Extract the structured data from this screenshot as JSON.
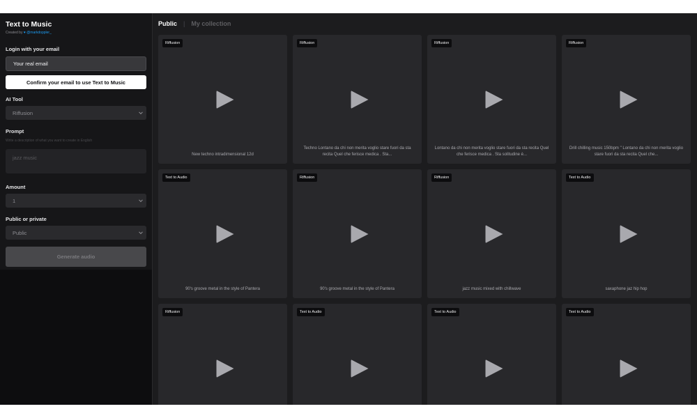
{
  "sidebar": {
    "title": "Text to Music",
    "created_prefix": "Created by",
    "created_handle": "@markdoppler_",
    "login_label": "Login with your email",
    "email_value": "Your real email",
    "confirm_button": "Confirm your email to use Text to Music",
    "ai_tool_label": "AI Tool",
    "ai_tool_value": "Riffusion",
    "prompt_label": "Prompt",
    "prompt_hint": "Write a description of what you want to create in English",
    "prompt_placeholder": "jazz music",
    "amount_label": "Amount",
    "amount_value": "1",
    "privacy_label": "Public or private",
    "privacy_value": "Public",
    "generate_button": "Generate audio"
  },
  "tabs": {
    "public": "Public",
    "separator": "|",
    "collection": "My collection"
  },
  "cards": [
    {
      "badge": "Riffusion",
      "caption": "New techno intradimensional 12d"
    },
    {
      "badge": "Riffusion",
      "caption": "Techno Lontano da chi non merita voglio stare fuori da sta recita Quel che ferisce medica . Sta..."
    },
    {
      "badge": "Riffusion",
      "caption": "Lontano da chi non merita voglio stare fuori da sta recita Quel che ferisce medica . Sta solitudine è..."
    },
    {
      "badge": "Riffusion",
      "caption": "Drill chilling music 150bpm \" Lontano da chi non merita voglio stare fuori da sta recita Quel che..."
    },
    {
      "badge": "Text to Audio",
      "caption": "90's groove metal in the style of Pantera"
    },
    {
      "badge": "Riffusion",
      "caption": "90's groove metal in the style of Pantera"
    },
    {
      "badge": "Riffusion",
      "caption": "jazz music mixed with chillwave"
    },
    {
      "badge": "Text to Audio",
      "caption": "saxaphone jaz hip hop"
    },
    {
      "badge": "Riffusion",
      "caption": ""
    },
    {
      "badge": "Text to Audio",
      "caption": ""
    },
    {
      "badge": "Text to Audio",
      "caption": ""
    },
    {
      "badge": "Text to Audio",
      "caption": ""
    }
  ]
}
